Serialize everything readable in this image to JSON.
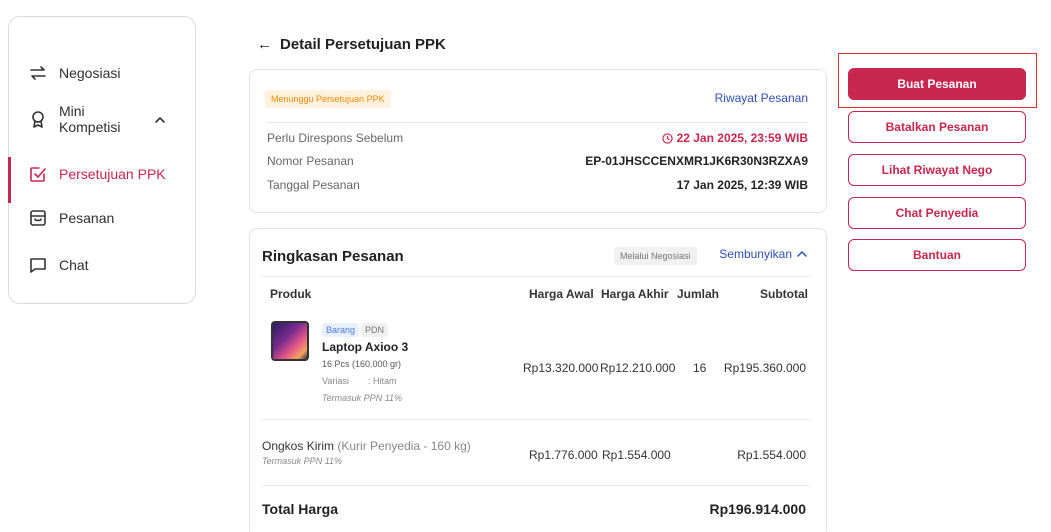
{
  "sidebar": {
    "items": [
      {
        "label": "Negosiasi",
        "icon": "swap-arrows-icon"
      },
      {
        "label": "Mini\nKompetisi",
        "icon": "award-ribbon-icon"
      },
      {
        "label": "Persetujuan PPK",
        "icon": "checkbox-edit-icon",
        "active": true
      },
      {
        "label": "Pesanan",
        "icon": "inbox-box-icon"
      },
      {
        "label": "Chat",
        "icon": "chat-bubble-icon"
      }
    ]
  },
  "header": {
    "title": "Detail Persetujuan PPK"
  },
  "info": {
    "status_badge": "Menunggu Persetujuan PPK",
    "history_link": "Riwayat Pesanan",
    "respond_label": "Perlu Direspons Sebelum",
    "respond_value": "22 Jan 2025, 23:59 WIB",
    "order_no_label": "Nomor Pesanan",
    "order_no_value": "EP-01JHSCCENXMR1JK6R30N3RZXA9",
    "order_date_label": "Tanggal Pesanan",
    "order_date_value": "17 Jan 2025, 12:39 WIB"
  },
  "summary": {
    "title": "Ringkasan Pesanan",
    "via_badge": "Melalui Negosiasi",
    "hide_link": "Sembunyikan",
    "columns": [
      "Produk",
      "Harga Awal",
      "Harga Akhir",
      "Jumlah",
      "Subtotal"
    ],
    "product": {
      "tag_type": "Barang",
      "tag_origin": "PDN",
      "name": "Laptop Axioo 3",
      "qty_weight": "16 Pcs (160.000 gr)",
      "variation_label": "Variasi",
      "variation_value": ": Hitam",
      "tax_note": "Termasuk PPN 11%",
      "price_initial": "Rp13.320.000",
      "price_final": "Rp12.210.000",
      "quantity": "16",
      "subtotal": "Rp195.360.000"
    },
    "shipping": {
      "label": "Ongkos Kirim",
      "detail": "(Kurir Penyedia - 160 kg)",
      "tax_note": "Termasuk PPN 11%",
      "price_initial": "Rp1.776.000",
      "price_final": "Rp1.554.000",
      "subtotal": "Rp1.554.000"
    },
    "total_label": "Total Harga",
    "total_value": "Rp196.914.000"
  },
  "actions": {
    "create_order": "Buat Pesanan",
    "cancel_order": "Batalkan Pesanan",
    "view_nego_history": "Lihat Riwayat Nego",
    "chat_provider": "Chat Penyedia",
    "help": "Bantuan"
  },
  "colors": {
    "brand": "#c8274f",
    "link": "#2e4fb8",
    "warning": "#f08a00"
  }
}
